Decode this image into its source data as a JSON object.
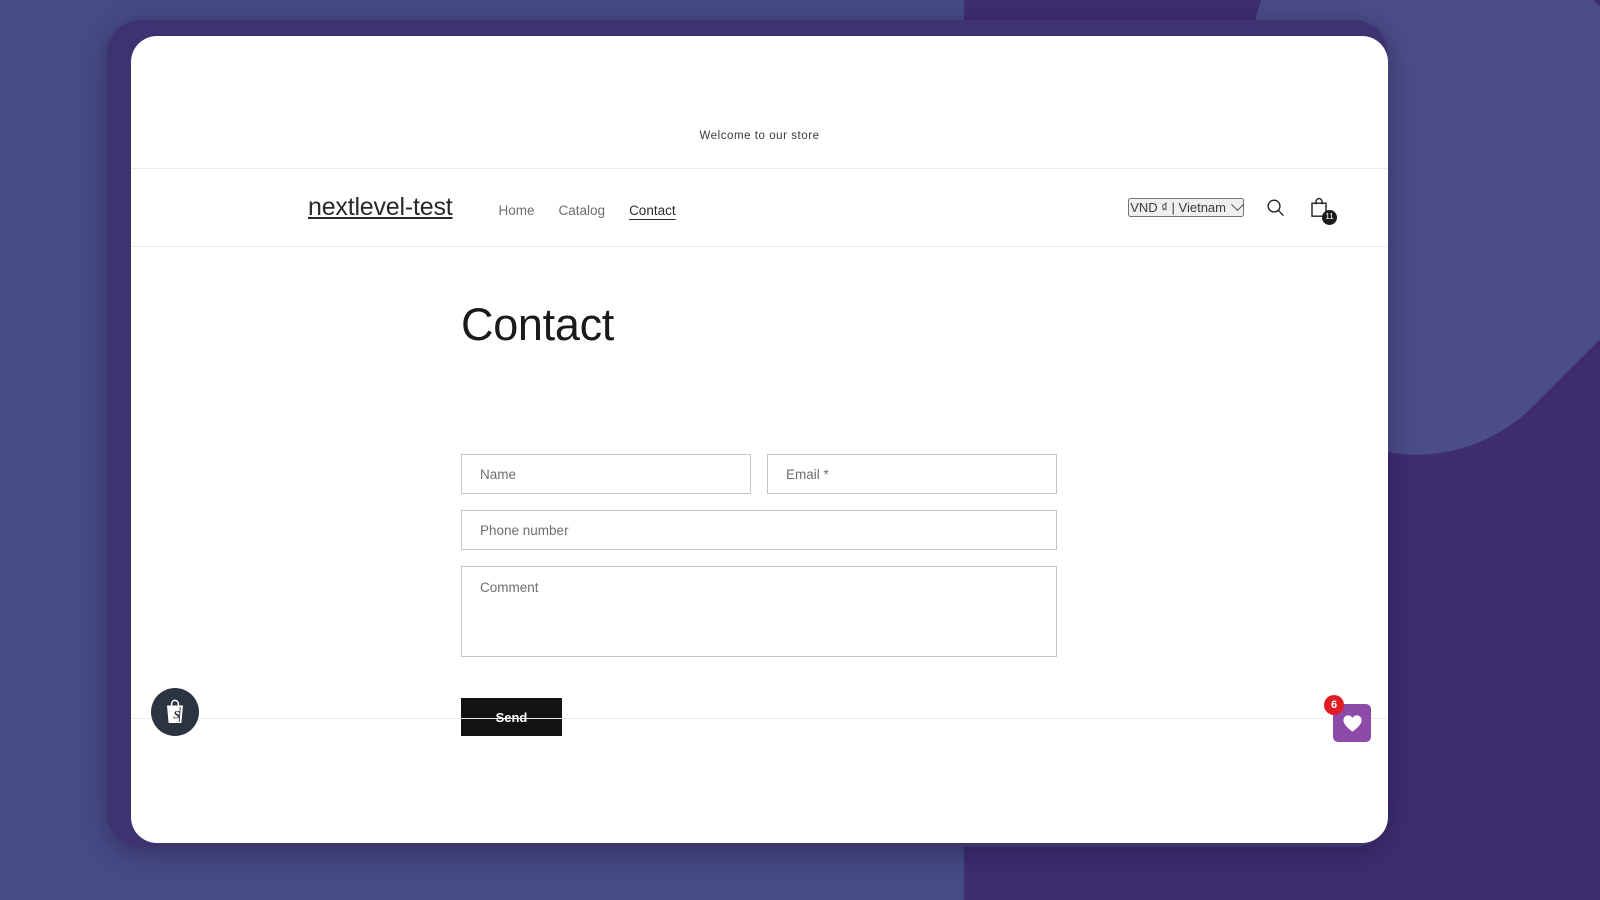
{
  "announcement": {
    "text": "Welcome to our store"
  },
  "header": {
    "logo": "nextlevel-test",
    "nav": [
      {
        "label": "Home",
        "active": false
      },
      {
        "label": "Catalog",
        "active": false
      },
      {
        "label": "Contact",
        "active": true
      }
    ],
    "locale": {
      "label": "VND ₫ | Vietnam",
      "chevron_icon": "chevron-down-icon"
    },
    "search_icon": "search-icon",
    "cart_icon": "shopping-bag-icon",
    "cart_count": "11"
  },
  "main": {
    "title": "Contact",
    "form": {
      "name_placeholder": "Name",
      "email_placeholder": "Email *",
      "phone_placeholder": "Phone number",
      "comment_placeholder": "Comment",
      "name_value": "",
      "email_value": "",
      "phone_value": "",
      "comment_value": "",
      "submit_label": "Send"
    }
  },
  "widgets": {
    "shopify_badge_icon": "shopify-bag-icon",
    "wishlist_icon": "heart-icon",
    "wishlist_count": "6"
  },
  "colors": {
    "background": "#474b85",
    "background_panel": "#3e2d70",
    "frame": "#3e3270",
    "decorative_heart": "#4a4d87",
    "submit_button": "#121212",
    "wishlist_widget": "#8e4aa8",
    "wishlist_badge": "#e01b24",
    "shopify_badge": "#2b3440"
  }
}
